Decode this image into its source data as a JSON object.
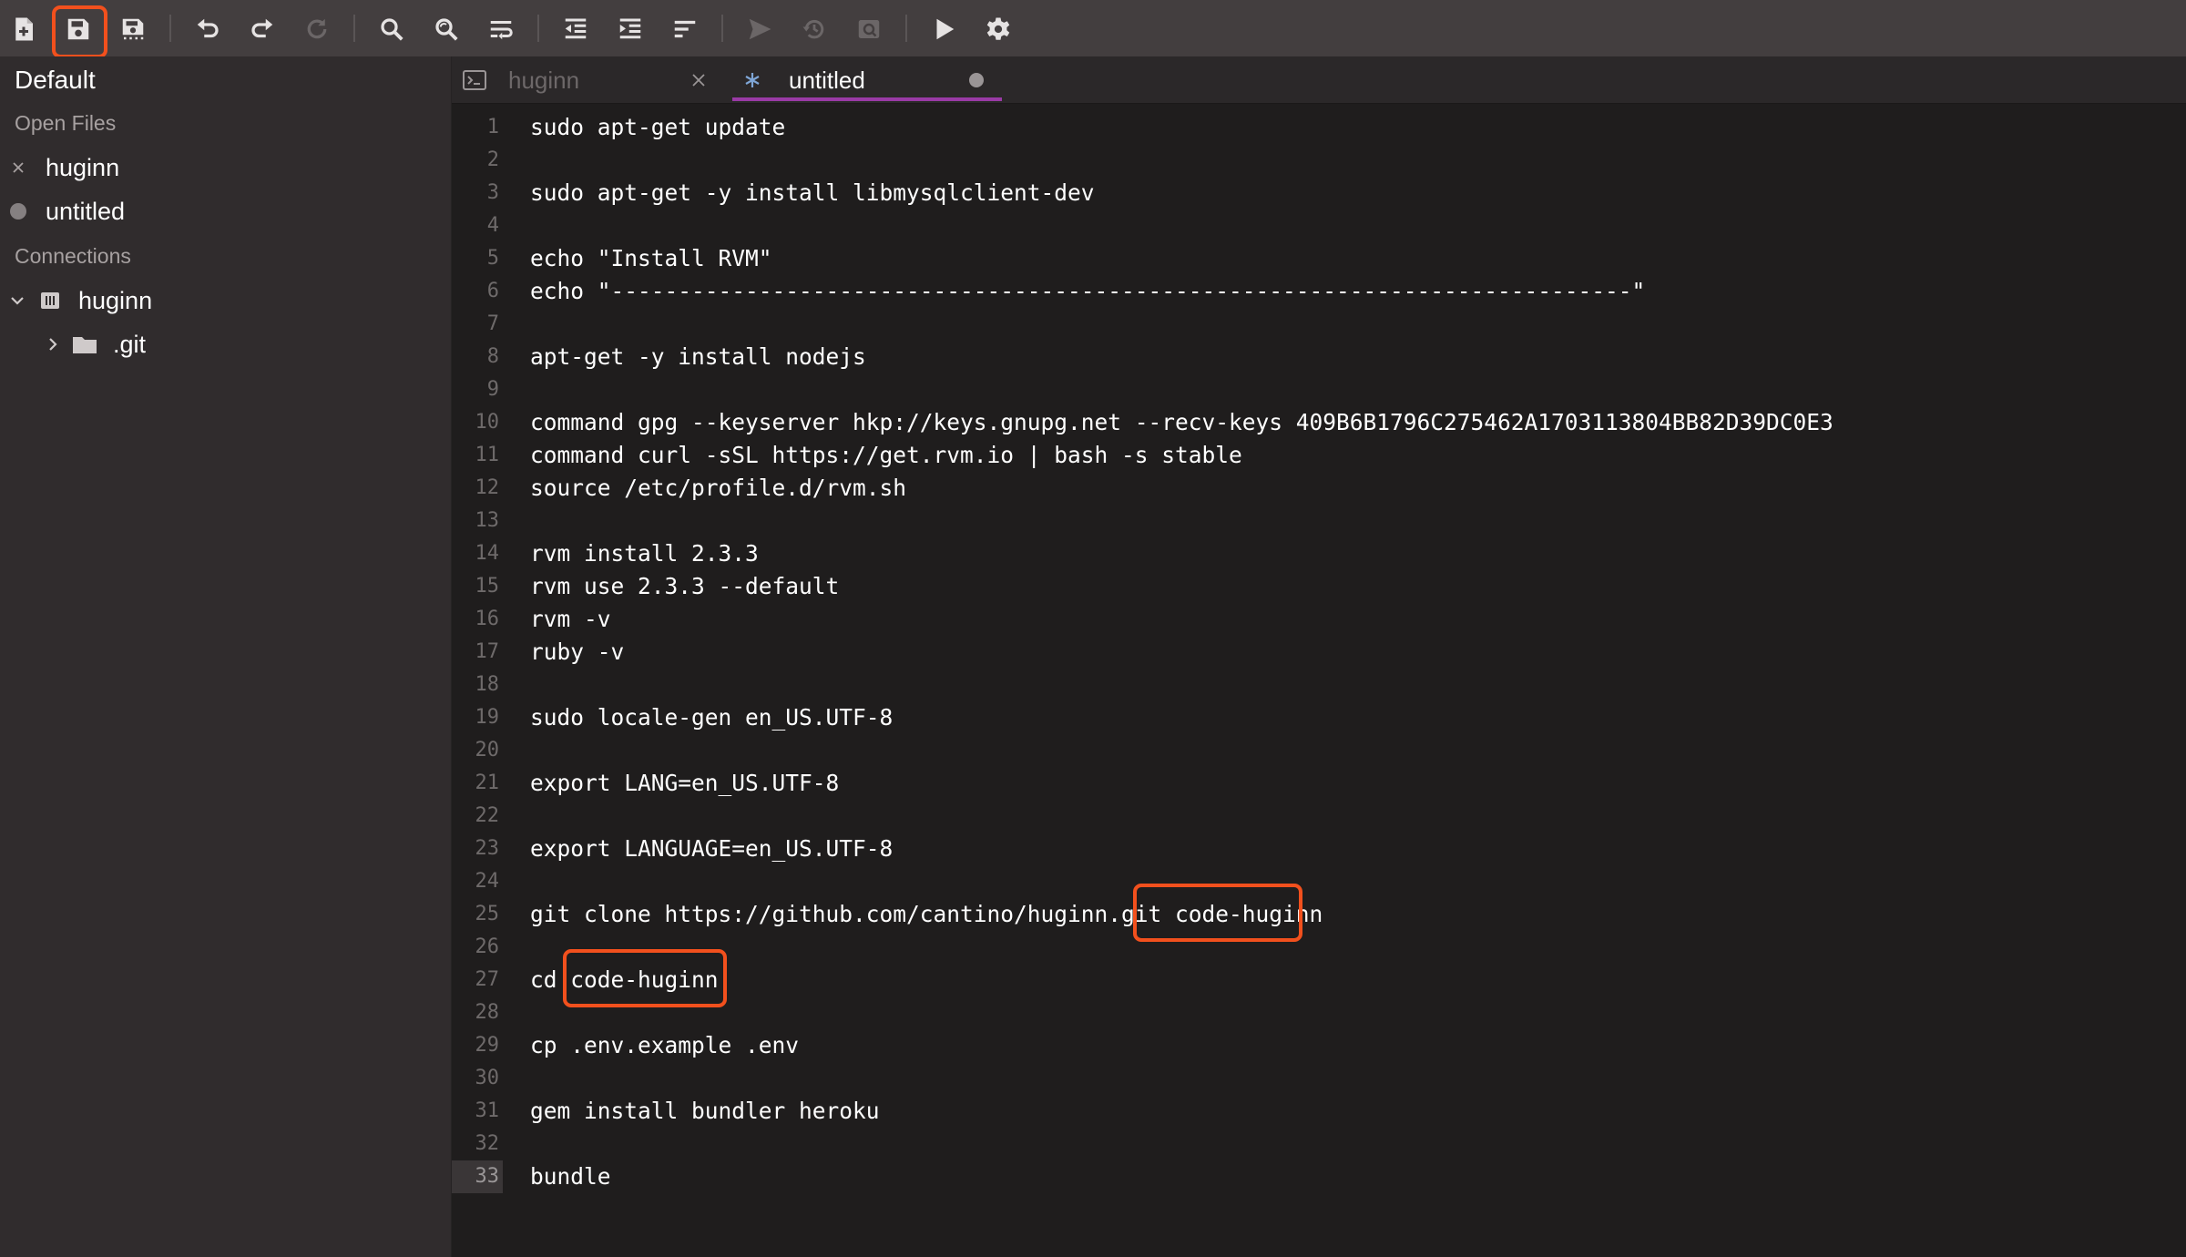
{
  "toolbar": {
    "buttons": [
      {
        "name": "new-file-icon"
      },
      {
        "name": "save-icon"
      },
      {
        "name": "save-all-icon"
      },
      {
        "name": "undo-icon"
      },
      {
        "name": "redo-icon"
      },
      {
        "name": "refresh-icon"
      },
      {
        "name": "search-icon"
      },
      {
        "name": "search-replace-icon"
      },
      {
        "name": "word-wrap-icon"
      },
      {
        "name": "outdent-icon"
      },
      {
        "name": "indent-icon"
      },
      {
        "name": "format-icon"
      },
      {
        "name": "send-icon"
      },
      {
        "name": "history-icon"
      },
      {
        "name": "screenshot-icon"
      },
      {
        "name": "run-icon"
      },
      {
        "name": "settings-icon"
      }
    ]
  },
  "sidebar": {
    "title": "Default",
    "open_files_label": "Open Files",
    "open_files": [
      {
        "label": "huginn",
        "state": "close"
      },
      {
        "label": "untitled",
        "state": "modified"
      }
    ],
    "connections_label": "Connections",
    "connections": [
      {
        "label": "huginn",
        "icon": "database-icon",
        "expanded": true
      },
      {
        "label": ".git",
        "icon": "folder-icon",
        "expanded": false
      }
    ]
  },
  "tabs": [
    {
      "label": "huginn",
      "icon": "terminal-icon",
      "active": false
    },
    {
      "label": "untitled",
      "icon": "asterisk-icon",
      "active": true
    }
  ],
  "editor": {
    "current_line": 33,
    "lines": [
      "sudo apt-get update",
      "",
      "sudo apt-get -y install libmysqlclient-dev",
      "",
      "echo \"Install RVM\"",
      "echo \"----------------------------------------------------------------------------\"",
      "",
      "apt-get -y install nodejs",
      "",
      "command gpg --keyserver hkp://keys.gnupg.net --recv-keys 409B6B1796C275462A1703113804BB82D39DC0E3",
      "command curl -sSL https://get.rvm.io | bash -s stable",
      "source /etc/profile.d/rvm.sh",
      "",
      "rvm install 2.3.3",
      "rvm use 2.3.3 --default",
      "rvm -v",
      "ruby -v",
      "",
      "sudo locale-gen en_US.UTF-8",
      "",
      "export LANG=en_US.UTF-8",
      "",
      "export LANGUAGE=en_US.UTF-8",
      "",
      "git clone https://github.com/cantino/huginn.git code-huginn",
      "",
      "cd code-huginn",
      "",
      "cp .env.example .env",
      "",
      "gem install bundler heroku",
      "",
      "bundle"
    ]
  },
  "colors": {
    "highlight": "#f2501d",
    "active_tab_underline": "#9a3aa6",
    "toolbar_bg": "#433e3f",
    "sidebar_bg": "#302c2d",
    "editor_bg": "#1f1d1d"
  }
}
